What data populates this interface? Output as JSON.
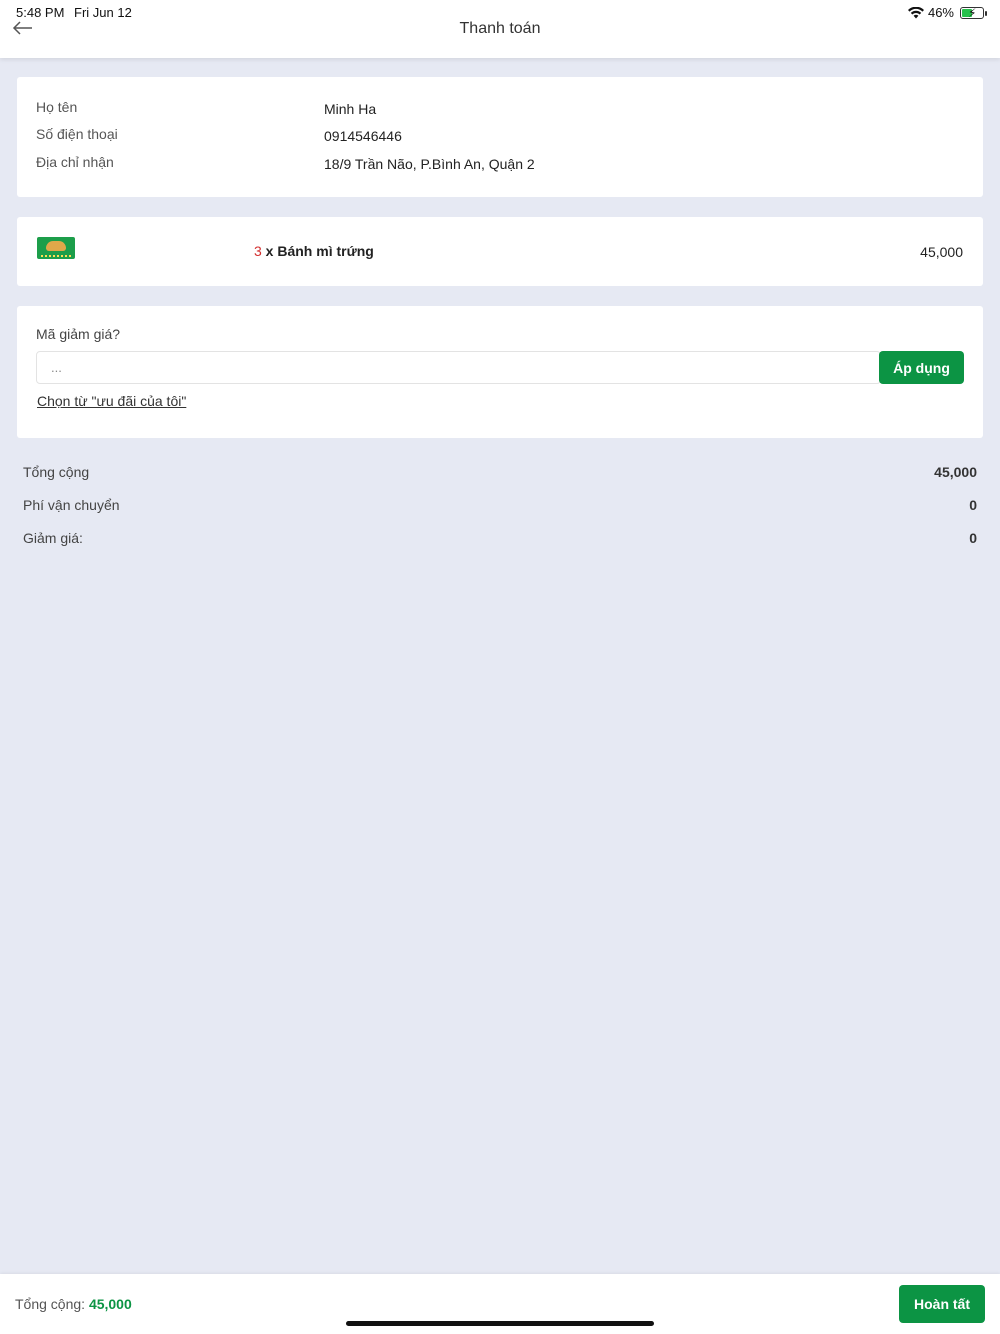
{
  "status_bar": {
    "time": "5:48 PM",
    "date": "Fri Jun 12",
    "battery": "46%"
  },
  "header": {
    "title": "Thanh toán"
  },
  "info": {
    "name_label": "Họ tên",
    "name_value": "Minh Ha",
    "phone_label": "Số điện thoại",
    "phone_value": "0914546446",
    "address_label": "Địa chỉ nhận",
    "address_value": "18/9 Trần Não, P.Bình An, Quận 2"
  },
  "item": {
    "quantity": "3",
    "name": " x Bánh mì trứng",
    "price": "45,000"
  },
  "coupon": {
    "title": "Mã giảm giá?",
    "placeholder": "...",
    "apply_label": "Áp dụng",
    "link_label": "Chọn từ \"ưu đãi của tôi\""
  },
  "summary": {
    "total_label": "Tổng cộng",
    "total_value": "45,000",
    "shipping_label": "Phí vận chuyển",
    "shipping_value": "0",
    "discount_label": "Giảm giá:",
    "discount_value": "0"
  },
  "footer": {
    "total_label": "Tổng cộng: ",
    "total_value": "45,000",
    "done_label": "Hoàn tất"
  },
  "colors": {
    "accent": "#0c9444",
    "quantity": "#d32f2f",
    "background": "#e6e9f3"
  }
}
